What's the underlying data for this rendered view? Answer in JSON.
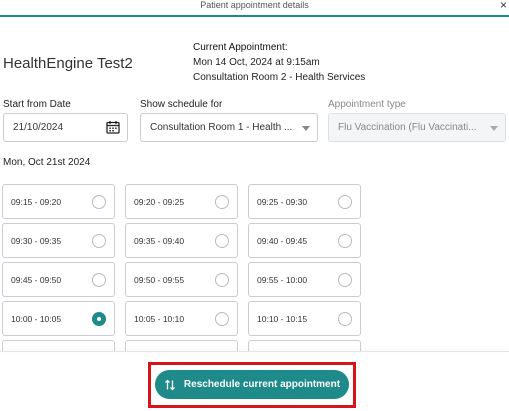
{
  "header": {
    "title": "Patient appointment details",
    "close_glyph": "×"
  },
  "patient": {
    "name": "HealthEngine Test2"
  },
  "current_appointment": {
    "heading": "Current Appointment:",
    "datetime": "Mon 14 Oct, 2024 at 9:15am",
    "location": "Consultation Room 2 - Health Services"
  },
  "filters": {
    "start_date": {
      "label": "Start from Date",
      "value": "21/10/2024",
      "icon": "calendar-icon"
    },
    "schedule": {
      "label": "Show schedule for",
      "value": "Consultation Room 1 - Health ...",
      "icon": "chevron-down-icon"
    },
    "appointment_type": {
      "label": "Appointment type",
      "value": "Flu Vaccination (Flu Vaccinati...",
      "icon": "chevron-down-icon",
      "disabled": true
    }
  },
  "schedule_date": "Mon, Oct 21st 2024",
  "slots": [
    {
      "time": "09:15 - 09:20",
      "selected": false
    },
    {
      "time": "09:20 - 09:25",
      "selected": false
    },
    {
      "time": "09:25 - 09:30",
      "selected": false
    },
    {
      "time": "09:30 - 09:35",
      "selected": false
    },
    {
      "time": "09:35 - 09:40",
      "selected": false
    },
    {
      "time": "09:40 - 09:45",
      "selected": false
    },
    {
      "time": "09:45 - 09:50",
      "selected": false
    },
    {
      "time": "09:50 - 09:55",
      "selected": false
    },
    {
      "time": "09:55 - 10:00",
      "selected": false
    },
    {
      "time": "10:00 - 10:05",
      "selected": true
    },
    {
      "time": "10:05 - 10:10",
      "selected": false
    },
    {
      "time": "10:10 - 10:15",
      "selected": false
    },
    {
      "time": "",
      "selected": false
    },
    {
      "time": "",
      "selected": false
    },
    {
      "time": "",
      "selected": false
    }
  ],
  "footer": {
    "reschedule_label": "Reschedule current appointment",
    "icon": "swap-vertical-icon"
  },
  "colors": {
    "accent": "#1e8a8a",
    "highlight": "#d7141a",
    "border": "#c9cdd1"
  }
}
